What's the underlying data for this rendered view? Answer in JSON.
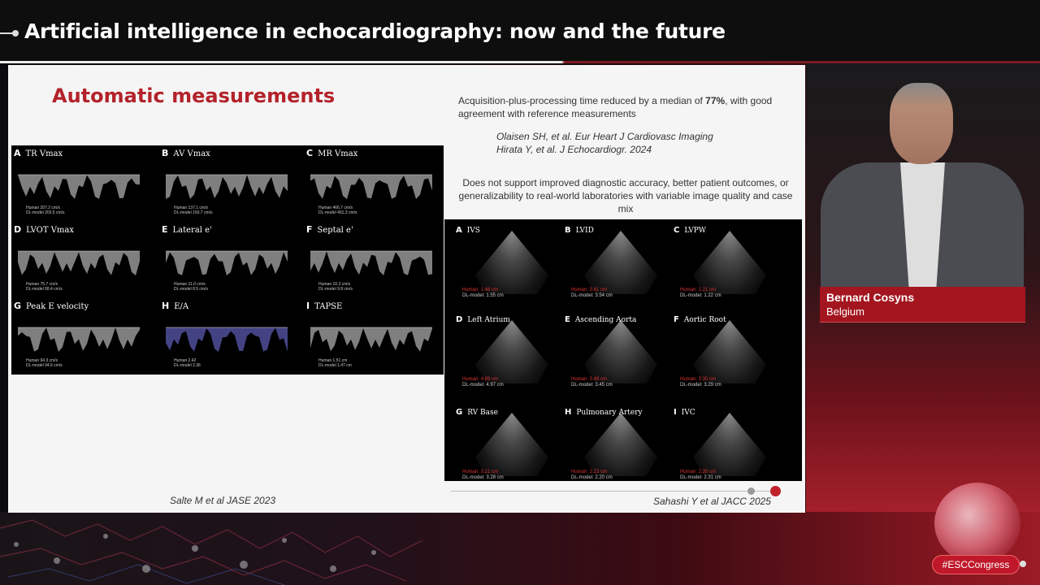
{
  "session_title": "Artificial intelligence in echocardiography: now and the future",
  "slide": {
    "heading": "Automatic measurements",
    "left_panels": [
      {
        "letter": "A",
        "label": "TR Vmax",
        "human": "Human 207.2 cm/s",
        "dl": "DL-model 203.5 cm/s"
      },
      {
        "letter": "B",
        "label": "AV Vmax",
        "human": "Human 137.1 cm/s",
        "dl": "DL-model 150.7 cm/s"
      },
      {
        "letter": "C",
        "label": "MR Vmax",
        "human": "Human 466.7 cm/s",
        "dl": "DL-model 491.3 cm/s"
      },
      {
        "letter": "D",
        "label": "LVOT Vmax",
        "human": "Human 75.7 cm/s",
        "dl": "DL-model 68.4 cm/s"
      },
      {
        "letter": "E",
        "label": "Lateral e'",
        "human": "Human 11.0 cm/s",
        "dl": "DL-model 8.5 cm/s"
      },
      {
        "letter": "F",
        "label": "Septal e'",
        "human": "Human 10.3 cm/s",
        "dl": "DL-model 9.8 cm/s"
      },
      {
        "letter": "G",
        "label": "Peak E velocity",
        "human": "Human 94.3 cm/s",
        "dl": "DL-model 94.6 cm/s"
      },
      {
        "letter": "H",
        "label": "E/A",
        "human": "Human 2.42",
        "dl": "DL-model 2.36"
      },
      {
        "letter": "I",
        "label": "TAPSE",
        "human": "Human 1.51 cm",
        "dl": "DL-model 1.47 cm"
      }
    ],
    "left_citation": "Salte M et al JASE 2023",
    "finding_1": {
      "before": "Acquisition-plus-processing time reduced by a median of ",
      "highlight": "77%",
      "after": ", with good agreement with reference measurements"
    },
    "refs": [
      "Olaisen SH, et al. Eur Heart J Cardiovasc Imaging",
      "Hirata Y, et al. J Echocardiogr. 2024"
    ],
    "finding_2": "Does not support improved diagnostic accuracy, better patient outcomes, or generalizability to real-world laboratories with variable image quality and case mix",
    "right_panels": [
      {
        "letter": "A",
        "label": "IVS",
        "human": "Human: 1.48 cm",
        "dl": "DL-model: 1.55 cm"
      },
      {
        "letter": "B",
        "label": "LVID",
        "human": "Human: 3.61 cm",
        "dl": "DL-model: 3.54 cm"
      },
      {
        "letter": "C",
        "label": "LVPW",
        "human": "Human: 1.21 cm",
        "dl": "DL-model: 1.22 cm"
      },
      {
        "letter": "D",
        "label": "Left Atrium",
        "human": "Human: 4.89 cm",
        "dl": "DL-model: 4.97 cm"
      },
      {
        "letter": "E",
        "label": "Ascending Aorta",
        "human": "Human: 3.48 cm",
        "dl": "DL-model: 3.45 cm"
      },
      {
        "letter": "F",
        "label": "Aortic Root",
        "human": "Human: 3.30 cm",
        "dl": "DL-model: 3.29 cm"
      },
      {
        "letter": "G",
        "label": "RV Base",
        "human": "Human: 3.21 cm",
        "dl": "DL-model: 3.28 cm"
      },
      {
        "letter": "H",
        "label": "Pulmonary Artery",
        "human": "Human: 2.23 cm",
        "dl": "DL-model: 2.20 cm"
      },
      {
        "letter": "I",
        "label": "IVC",
        "human": "Human: 2.35 cm",
        "dl": "DL-model: 2.31 cm"
      }
    ],
    "right_citation": "Sahashi Y et al JACC 2025"
  },
  "speaker": {
    "name": "Bernard Cosyns",
    "country": "Belgium"
  },
  "hashtag": "#ESCCongress",
  "colors": {
    "accent": "#b3222a",
    "plate": "#a3161f"
  }
}
